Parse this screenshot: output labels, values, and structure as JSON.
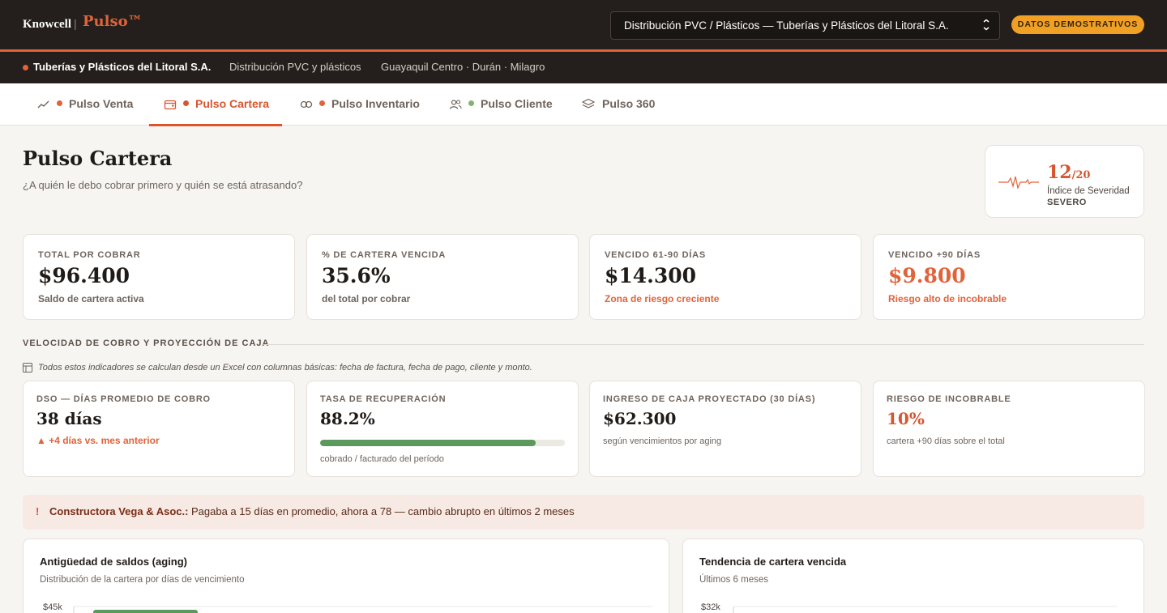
{
  "brand": {
    "left": "Knowcell",
    "separator": "|",
    "right": "Pulso™"
  },
  "company_selector": {
    "value": "Distribución PVC / Plásticos — Tuberías y Plásticos del Litoral S.A."
  },
  "demo_badge": "DATOS DEMOSTRATIVOS",
  "company_bar": {
    "name": "Tuberías y Plásticos del Litoral S.A.",
    "sector": "Distribución PVC y plásticos",
    "locations": "Guayaquil Centro · Durán · Milagro"
  },
  "tabs": [
    {
      "label": "Pulso Venta",
      "icon": "trend-icon",
      "dot": "#e0633a"
    },
    {
      "label": "Pulso Cartera",
      "icon": "wallet-icon",
      "dot": "#d8552e",
      "active": true
    },
    {
      "label": "Pulso Inventario",
      "icon": "infinity-icon",
      "dot": "#e0633a"
    },
    {
      "label": "Pulso Cliente",
      "icon": "users-icon",
      "dot": "#7fb56f"
    },
    {
      "label": "Pulso 360",
      "icon": "layers-icon"
    }
  ],
  "header": {
    "title": "Pulso Cartera",
    "subtitle": "¿A quién le debo cobrar primero y quién se está atrasando?"
  },
  "severity": {
    "score": "12",
    "denominator": "/20",
    "label": "Índice de Severidad",
    "level": "SEVERO"
  },
  "kpis": [
    {
      "label": "TOTAL POR COBRAR",
      "value": "$96.400",
      "note": "Saldo de cartera activa"
    },
    {
      "label": "% DE CARTERA VENCIDA",
      "value": "35.6%",
      "note": "del total por cobrar"
    },
    {
      "label": "VENCIDO 61-90 DÍAS",
      "value": "$14.300",
      "note": "Zona de riesgo creciente"
    },
    {
      "label": "VENCIDO +90 DÍAS",
      "value": "$9.800",
      "note": "Riesgo alto de incobrable"
    }
  ],
  "section": {
    "title": "VELOCIDAD DE COBRO Y PROYECCIÓN DE CAJA",
    "note": "Todos estos indicadores se calculan desde un Excel con columnas básicas: fecha de factura, fecha de pago, cliente y monto."
  },
  "kpis2": [
    {
      "label": "DSO — DÍAS PROMEDIO DE COBRO",
      "value": "38 días",
      "note": "▲ +4 días vs. mes anterior"
    },
    {
      "label": "TASA DE RECUPERACIÓN",
      "value": "88.2%",
      "note": "cobrado / facturado del período",
      "progress": 0.882
    },
    {
      "label": "INGRESO DE CAJA PROYECTADO (30 DÍAS)",
      "value": "$62.300",
      "note": "según vencimientos por aging"
    },
    {
      "label": "RIESGO DE INCOBRABLE",
      "value": "10%",
      "note": "cartera +90 días sobre el total"
    }
  ],
  "alert": {
    "icon": "!",
    "name": "Constructora Vega & Asoc.:",
    "text": "Pagaba a 15 días en promedio, ahora a 78 — cambio abrupto en últimos 2 meses"
  },
  "charts": [
    {
      "title": "Antigüedad de saldos (aging)",
      "subtitle": "Distribución de la cartera por días de vencimiento",
      "y_tick": "$45k"
    },
    {
      "title": "Tendencia de cartera vencida",
      "subtitle": "Últimos 6 meses",
      "y_tick": "$32k"
    }
  ],
  "colors": {
    "accent": "#e0633a",
    "accent_dark": "#d8552e",
    "dark": "#241f1c",
    "badge": "#f0a024",
    "green": "#5b9a5c"
  }
}
